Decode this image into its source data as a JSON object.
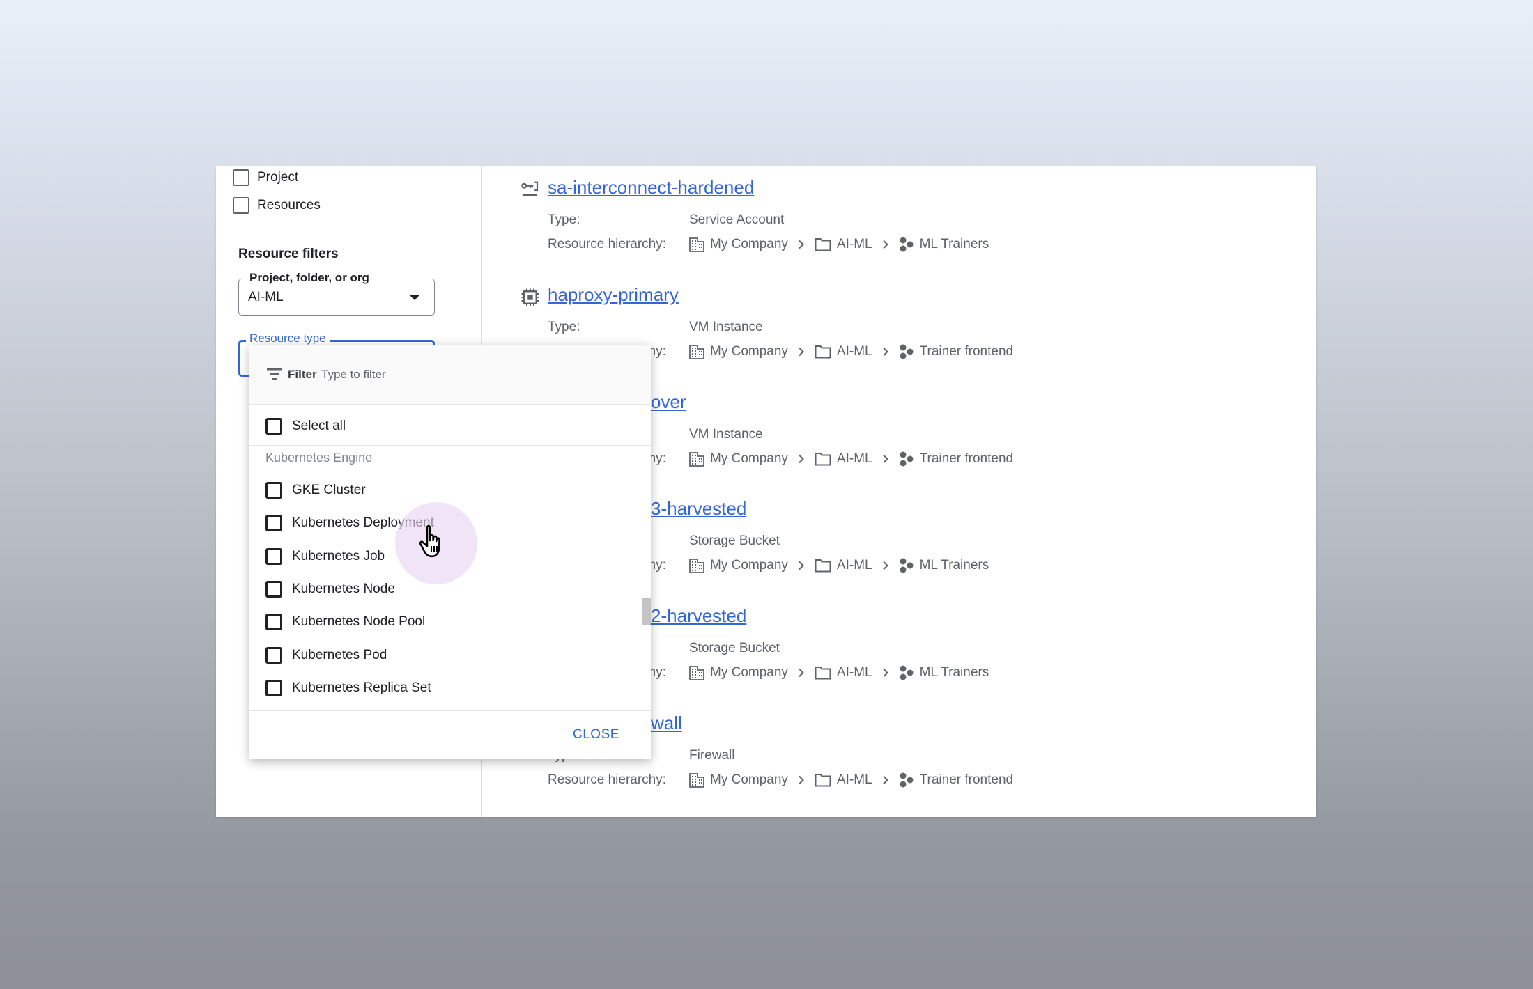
{
  "sidebar": {
    "scope_options": [
      {
        "label": "Project",
        "checked": false
      },
      {
        "label": "Resources",
        "checked": false
      }
    ],
    "resource_filters_title": "Resource filters",
    "project_select": {
      "label": "Project, folder, or org",
      "value": "AI-ML"
    },
    "resource_type_field": {
      "label": "Resource type"
    }
  },
  "dropdown": {
    "filter_label": "Filter",
    "filter_placeholder": "Type to filter",
    "select_all": "Select all",
    "group_header": "Kubernetes Engine",
    "options": [
      {
        "label": "GKE Cluster",
        "checked": false
      },
      {
        "label": "Kubernetes Deployment",
        "checked": false
      },
      {
        "label": "Kubernetes Job",
        "checked": false
      },
      {
        "label": "Kubernetes Node",
        "checked": false
      },
      {
        "label": "Kubernetes Node Pool",
        "checked": false
      },
      {
        "label": "Kubernetes Pod",
        "checked": false
      },
      {
        "label": "Kubernetes Replica Set",
        "checked": false
      }
    ],
    "close_label": "CLOSE"
  },
  "labels": {
    "type": "Type:",
    "hierarchy": "Resource hierarchy:"
  },
  "results": [
    {
      "name": "sa-interconnect-hardened",
      "icon": "service-account-icon",
      "type": "Service Account",
      "hierarchy": [
        "My Company",
        "AI-ML",
        "ML Trainers"
      ]
    },
    {
      "name": "haproxy-primary",
      "icon": "chip-icon",
      "type": "VM Instance",
      "hierarchy": [
        "My Company",
        "AI-ML",
        "Trainer frontend"
      ]
    },
    {
      "name": "over",
      "type": "VM Instance",
      "hierarchy": [
        "My Company",
        "AI-ML",
        "Trainer frontend"
      ]
    },
    {
      "name": "3-harvested",
      "type": "Storage Bucket",
      "hierarchy": [
        "My Company",
        "AI-ML",
        "ML Trainers"
      ]
    },
    {
      "name": "2-harvested",
      "type": "Storage Bucket",
      "hierarchy": [
        "My Company",
        "AI-ML",
        "ML Trainers"
      ]
    },
    {
      "name": "wall",
      "type": "Firewall",
      "hierarchy": [
        "My Company",
        "AI-ML",
        "Trainer frontend"
      ]
    }
  ],
  "colors": {
    "accent": "#3367d6",
    "text": "#202124",
    "muted": "#5f6368"
  }
}
